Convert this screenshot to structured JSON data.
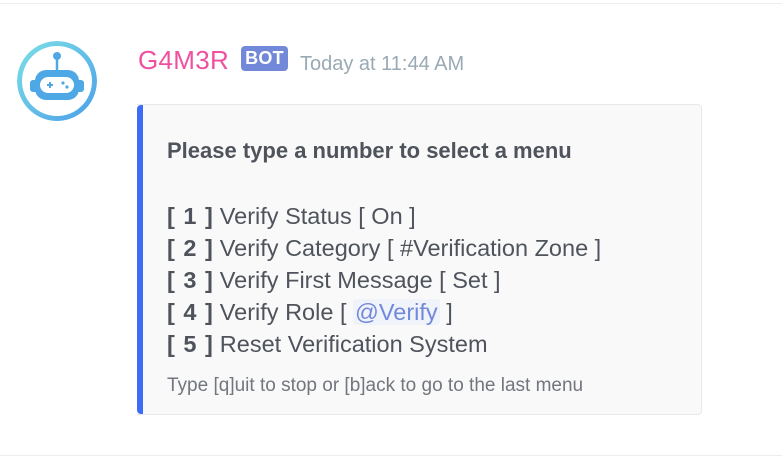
{
  "message": {
    "author": {
      "name": "G4M3R",
      "name_color": "#f0509f",
      "bot_tag": "BOT",
      "avatar_icon": "robot-icon"
    },
    "timestamp": "Today at 11:44 AM",
    "embed": {
      "accent_color": "#3e6cf8",
      "title": "Please type a number to select a menu",
      "lines": [
        {
          "number": "[ 1 ]",
          "text": "Verify Status [ On ]"
        },
        {
          "number": "[ 2 ]",
          "text": "Verify Category [ #Verification Zone ]"
        },
        {
          "number": "[ 3 ]",
          "text": "Verify First Message [ Set ]"
        },
        {
          "number": "[ 4 ]",
          "text_before": "Verify Role [",
          "mention": "@Verify",
          "text_after": "]"
        },
        {
          "number": "[ 5 ]",
          "text": "Reset Verification System"
        }
      ],
      "footer": "Type [q]uit to stop or [b]ack to go to the last menu"
    }
  }
}
